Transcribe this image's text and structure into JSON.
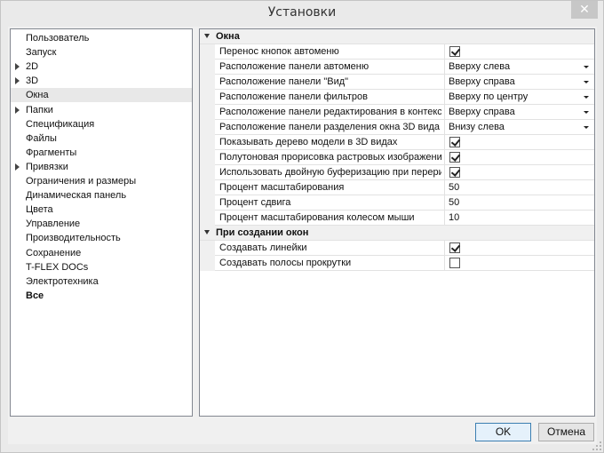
{
  "window": {
    "title": "Установки",
    "close_symbol": "✕"
  },
  "tree": {
    "items": [
      {
        "label": "Пользователь",
        "expandable": false,
        "selected": false,
        "bold": false
      },
      {
        "label": "Запуск",
        "expandable": false,
        "selected": false,
        "bold": false
      },
      {
        "label": "2D",
        "expandable": true,
        "selected": false,
        "bold": false
      },
      {
        "label": "3D",
        "expandable": true,
        "selected": false,
        "bold": false
      },
      {
        "label": "Окна",
        "expandable": false,
        "selected": true,
        "bold": false
      },
      {
        "label": "Папки",
        "expandable": true,
        "selected": false,
        "bold": false
      },
      {
        "label": "Спецификация",
        "expandable": false,
        "selected": false,
        "bold": false
      },
      {
        "label": "Файлы",
        "expandable": false,
        "selected": false,
        "bold": false
      },
      {
        "label": "Фрагменты",
        "expandable": false,
        "selected": false,
        "bold": false
      },
      {
        "label": "Привязки",
        "expandable": true,
        "selected": false,
        "bold": false
      },
      {
        "label": "Ограничения и размеры",
        "expandable": false,
        "selected": false,
        "bold": false
      },
      {
        "label": "Динамическая панель",
        "expandable": false,
        "selected": false,
        "bold": false
      },
      {
        "label": "Цвета",
        "expandable": false,
        "selected": false,
        "bold": false
      },
      {
        "label": "Управление",
        "expandable": false,
        "selected": false,
        "bold": false
      },
      {
        "label": "Производительность",
        "expandable": false,
        "selected": false,
        "bold": false
      },
      {
        "label": "Сохранение",
        "expandable": false,
        "selected": false,
        "bold": false
      },
      {
        "label": "T-FLEX DOCs",
        "expandable": false,
        "selected": false,
        "bold": false
      },
      {
        "label": "Электротехника",
        "expandable": false,
        "selected": false,
        "bold": false
      },
      {
        "label": "Все",
        "expandable": false,
        "selected": false,
        "bold": true
      }
    ]
  },
  "grid": {
    "groups": [
      {
        "label": "Окна",
        "rows": [
          {
            "name": "Перенос кнопок автоменю",
            "type": "checkbox",
            "checked": true
          },
          {
            "name": "Расположение панели автоменю",
            "type": "dropdown",
            "value": "Вверху слева"
          },
          {
            "name": "Расположение панели \"Вид\"",
            "type": "dropdown",
            "value": "Вверху справа"
          },
          {
            "name": "Расположение панели фильтров",
            "type": "dropdown",
            "value": "Вверху по центру"
          },
          {
            "name": "Расположение панели редактирования в контексте...",
            "type": "dropdown",
            "value": "Вверху справа"
          },
          {
            "name": "Расположение панели разделения окна 3D вида",
            "type": "dropdown",
            "value": "Внизу слева"
          },
          {
            "name": "Показывать дерево модели в 3D видах",
            "type": "checkbox",
            "checked": true
          },
          {
            "name": "Полутоновая прорисовка растровых изображений",
            "type": "checkbox",
            "checked": true
          },
          {
            "name": "Использовать двойную буферизацию при перерис...",
            "type": "checkbox",
            "checked": true
          },
          {
            "name": "Процент масштабирования",
            "type": "text",
            "value": "50"
          },
          {
            "name": "Процент сдвига",
            "type": "text",
            "value": "50"
          },
          {
            "name": "Процент масштабирования колесом мыши",
            "type": "text",
            "value": "10"
          }
        ]
      },
      {
        "label": "При создании окон",
        "rows": [
          {
            "name": "Создавать линейки",
            "type": "checkbox",
            "checked": true
          },
          {
            "name": "Создавать полосы прокрутки",
            "type": "checkbox",
            "checked": false
          }
        ]
      }
    ]
  },
  "buttons": {
    "ok_label": "OK",
    "cancel_label": "Отмена"
  },
  "colors": {
    "selection": "#e8e8e8",
    "default_button_border": "#3c7fb1",
    "window_bg": "#f0f0f0"
  }
}
